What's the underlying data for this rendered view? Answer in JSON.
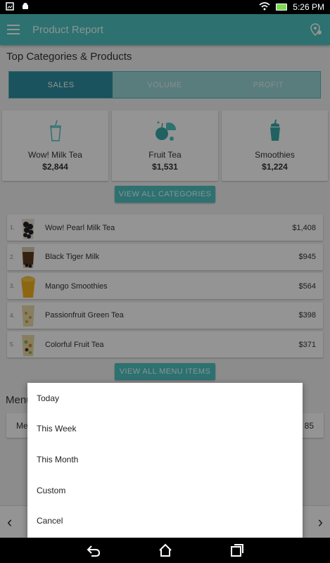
{
  "status_bar": {
    "time": "5:26 PM"
  },
  "app_bar": {
    "title": "Product Report"
  },
  "section": {
    "title": "Top Categories & Products"
  },
  "tabs": [
    {
      "label": "SALES"
    },
    {
      "label": "VOLUME"
    },
    {
      "label": "PROFIT"
    }
  ],
  "categories": [
    {
      "name": "Wow! Milk Tea",
      "value": "$2,844",
      "icon": "milk-tea-cup-icon"
    },
    {
      "name": "Fruit Tea",
      "value": "$1,531",
      "icon": "fruit-icon"
    },
    {
      "name": "Smoothies",
      "value": "$1,224",
      "icon": "smoothie-cup-icon"
    }
  ],
  "buttons": {
    "view_all_categories": "VIEW ALL CATEGORIES",
    "view_all_menu_items": "VIEW ALL MENU ITEMS"
  },
  "products": [
    {
      "rank": "1.",
      "name": "Wow! Pearl Milk Tea",
      "value": "$1,408"
    },
    {
      "rank": "2.",
      "name": "Black Tiger Milk",
      "value": "$945"
    },
    {
      "rank": "3.",
      "name": "Mango Smoothies",
      "value": "$564"
    },
    {
      "rank": "4.",
      "name": "Passionfruit Green Tea",
      "value": "$398"
    },
    {
      "rank": "5.",
      "name": "Colorful Fruit Tea",
      "value": "$371"
    }
  ],
  "menu_section": {
    "label_partial": "Menu",
    "card_label_partial": "Me",
    "card_value_partial": "85"
  },
  "dialog": {
    "options": [
      "Today",
      "This Week",
      "This Month",
      "Custom",
      "Cancel"
    ]
  },
  "colors": {
    "accent": "#4ec3c1",
    "active_tab": "#2e8fa1"
  }
}
